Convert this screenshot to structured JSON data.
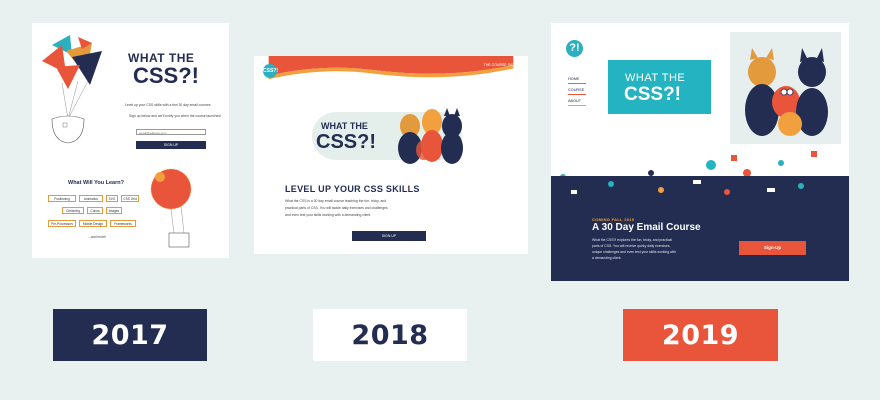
{
  "years": {
    "y2017": "2017",
    "y2018": "2018",
    "y2019": "2019"
  },
  "v2017": {
    "title_line1": "WHAT THE",
    "title_line2": "CSS?!",
    "intro": "Level up your CSS skills with a few 30 day email courses",
    "signup_text": "Sign up below and we'll notify you when the course launches!",
    "email_placeholder": "email@address.com",
    "signup_button": "SIGN UP",
    "learn_heading": "What Will You Learn?",
    "topics": [
      "Positioning",
      "Animation",
      "SVG",
      "CSS Grid",
      "Centering",
      "Colors",
      "Images",
      "Pre-Processors",
      "Mobile Design",
      "Frameworks"
    ],
    "more": "...and more!"
  },
  "v2018": {
    "logo": "CSS?!",
    "nav": "THE COURSE   SIGN UP",
    "title_line1": "WHAT THE",
    "title_line2": "CSS?!",
    "heading": "LEVEL UP YOUR CSS SKILLS",
    "body_line1": "What the CSS is a 30 day email course teaching the fun, tricky, and",
    "body_line2": "practical parts of CSS. You will tackle daily exercises and challenges",
    "body_line3": "and even test your skills working with a demanding client.",
    "signup_button": "SIGN UP"
  },
  "v2019": {
    "logo": "?!",
    "nav": [
      "HOME",
      "COURSE",
      "ABOUT"
    ],
    "nav_colors": [
      "#24b3c0",
      "#e8553a",
      "#f2a03d"
    ],
    "title_line1": "WHAT THE",
    "title_line2": "CSS?!",
    "coming": "COMING FALL 2019",
    "heading": "A 30 Day Email Course",
    "body_line1": "What the CSS?! explores the fun, tricky, and practical",
    "body_line2": "parts of CSS. You will receive quirky daily exercises,",
    "body_line3": "unique challenges and even test your skills working with",
    "body_line4": "a demanding client.",
    "signup_button": "Sign-Up"
  },
  "colors": {
    "navy": "#232d52",
    "teal": "#24b3c0",
    "orange": "#e8553a",
    "amber": "#f2a03d",
    "background": "#e9f1f0"
  }
}
